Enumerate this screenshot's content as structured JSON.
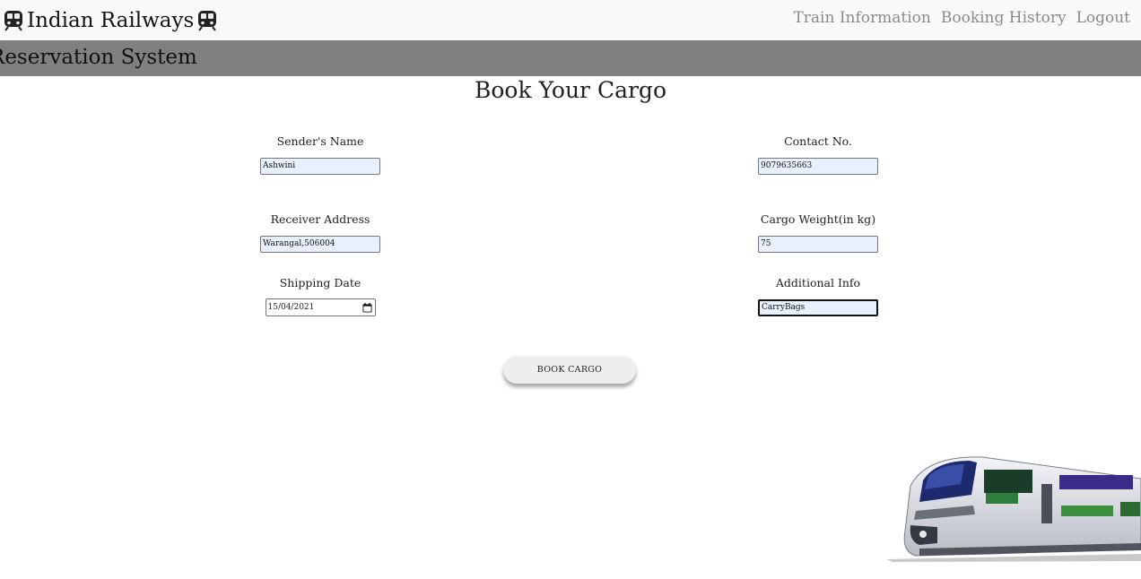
{
  "navbar": {
    "brand": "Indian Railways",
    "brand_icon_left": "train-icon",
    "brand_icon_right": "train-icon",
    "links": [
      "Train Information",
      "Booking History",
      "Logout"
    ]
  },
  "banner": {
    "text": "Reservation System"
  },
  "page": {
    "title": "Book Your Cargo"
  },
  "form": {
    "sender_name": {
      "label": "Sender's Name",
      "value": "Ashwini"
    },
    "contact": {
      "label": "Contact No.",
      "value": "9079635663"
    },
    "receiver_address": {
      "label": "Receiver Address",
      "value": "Warangal,506004"
    },
    "cargo_weight": {
      "label": "Cargo Weight(in kg)",
      "value": "75"
    },
    "shipping_date": {
      "label": "Shipping Date",
      "value": "15/04/2021",
      "icon": "calendar-icon"
    },
    "additional_info": {
      "label": "Additional Info",
      "value": "CarryBags"
    },
    "submit_label": "BOOK CARGO"
  },
  "decor": {
    "image": "train-image"
  }
}
